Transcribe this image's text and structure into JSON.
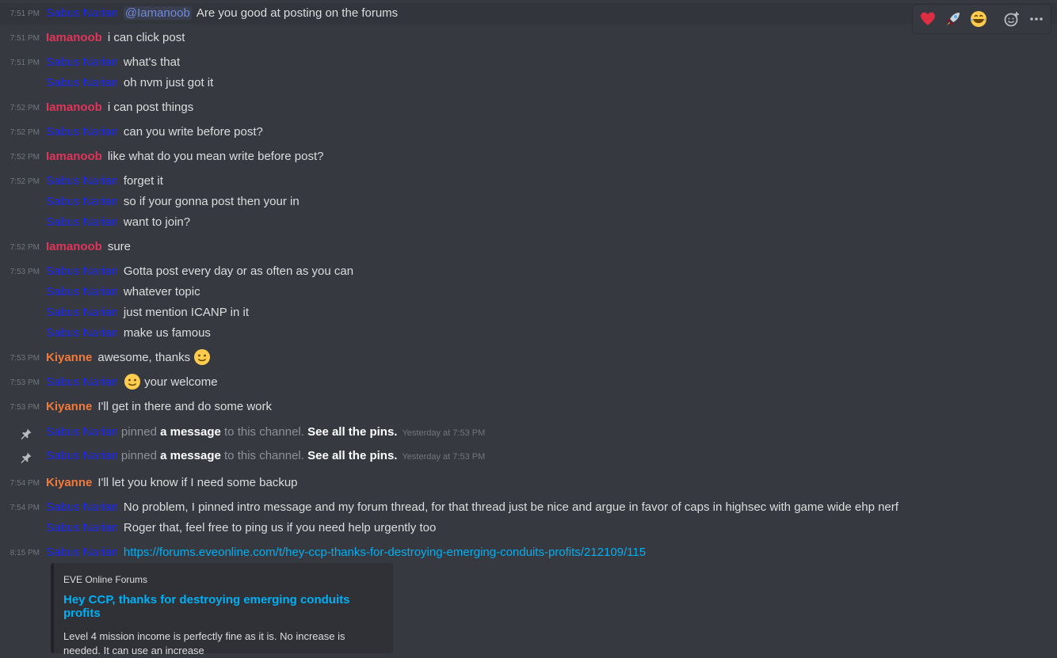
{
  "messages": [
    {
      "time": "7:51 PM",
      "author": "Sabus Narian",
      "kind": "sab",
      "mention": "@Iamanoob",
      "text": "Are you good at posting on the forums"
    },
    {
      "time": "7:51 PM",
      "author": "Iamanoob",
      "kind": "lama",
      "text": "i can click post"
    },
    {
      "time": "7:51 PM",
      "author": "Sabus Narian",
      "kind": "sab",
      "text": "what's that"
    },
    {
      "time": "",
      "author": "Sabus Narian",
      "kind": "sab",
      "text": "oh nvm just got it"
    },
    {
      "time": "7:52 PM",
      "author": "Iamanoob",
      "kind": "lama",
      "text": "i can post things"
    },
    {
      "time": "7:52 PM",
      "author": "Sabus Narian",
      "kind": "sab",
      "text": "can you write before post?"
    },
    {
      "time": "7:52 PM",
      "author": "Iamanoob",
      "kind": "lama",
      "text": "like what do you mean write before post?"
    },
    {
      "time": "7:52 PM",
      "author": "Sabus Narian",
      "kind": "sab",
      "text": "forget it"
    },
    {
      "time": "",
      "author": "Sabus Narian",
      "kind": "sab",
      "text": "so if your gonna post then your in"
    },
    {
      "time": "",
      "author": "Sabus Narian",
      "kind": "sab",
      "text": "want to join?"
    },
    {
      "time": "7:52 PM",
      "author": "Iamanoob",
      "kind": "lama",
      "text": "sure"
    },
    {
      "time": "7:53 PM",
      "author": "Sabus Narian",
      "kind": "sab",
      "text": "Gotta post every day or as often as you can"
    },
    {
      "time": "",
      "author": "Sabus Narian",
      "kind": "sab",
      "text": "whatever topic"
    },
    {
      "time": "",
      "author": "Sabus Narian",
      "kind": "sab",
      "text": "just mention ICANP in it"
    },
    {
      "time": "",
      "author": "Sabus Narian",
      "kind": "sab",
      "text": "make us famous"
    },
    {
      "time": "7:53 PM",
      "author": "Kiyanne",
      "kind": "kiy",
      "text": "awesome, thanks",
      "emoji_after": "slight-smile"
    },
    {
      "time": "7:53 PM",
      "author": "Sabus Narian",
      "kind": "sab",
      "text": "your welcome",
      "emoji_before": "slight-smile"
    },
    {
      "time": "7:53 PM",
      "author": "Kiyanne",
      "kind": "kiy",
      "text": "I'll get in there and do some work"
    },
    {
      "system": true,
      "author": "Sabus Narian",
      "pre": "pinned",
      "bold1": "a message",
      "mid": "to this channel.",
      "bold2": "See all the pins.",
      "stamp": "Yesterday at 7:53 PM"
    },
    {
      "system": true,
      "author": "Sabus Narian",
      "pre": "pinned",
      "bold1": "a message",
      "mid": "to this channel.",
      "bold2": "See all the pins.",
      "stamp": "Yesterday at 7:53 PM"
    },
    {
      "time": "7:54 PM",
      "author": "Kiyanne",
      "kind": "kiy",
      "text": "I'll let you know if I need some backup"
    },
    {
      "time": "7:54 PM",
      "author": "Sabus Narian",
      "kind": "sab",
      "text": "No problem, I pinned intro message and my forum thread, for that thread just be nice and argue in favor of caps in highsec with game wide ehp nerf"
    },
    {
      "time": "",
      "author": "Sabus Narian",
      "kind": "sab",
      "text": "Roger that, feel free to ping us if you need help urgently too"
    },
    {
      "time": "8:15 PM",
      "author": "Sabus Narian",
      "kind": "sab",
      "link": "https://forums.eveonline.com/t/hey-ccp-thanks-for-destroying-emerging-conduits-profits/212109/115"
    }
  ],
  "embed": {
    "provider": "EVE Online Forums",
    "title": "Hey CCP, thanks for destroying emerging conduits profits",
    "description": "Level 4 mission income is perfectly fine as it is. No increase is needed. It can use an increase"
  },
  "reaction_bar": {
    "buttons": [
      "heart-icon",
      "rocket-icon",
      "joy-icon",
      "add-reaction-icon",
      "more-options-icon"
    ]
  },
  "colors": {
    "background": "#36393f",
    "author_sabus": "#1c27f2",
    "author_iamanoob": "#e0355b",
    "author_kiyanne": "#f17a3b",
    "link": "#00b0f4",
    "mention": "#7289da"
  }
}
